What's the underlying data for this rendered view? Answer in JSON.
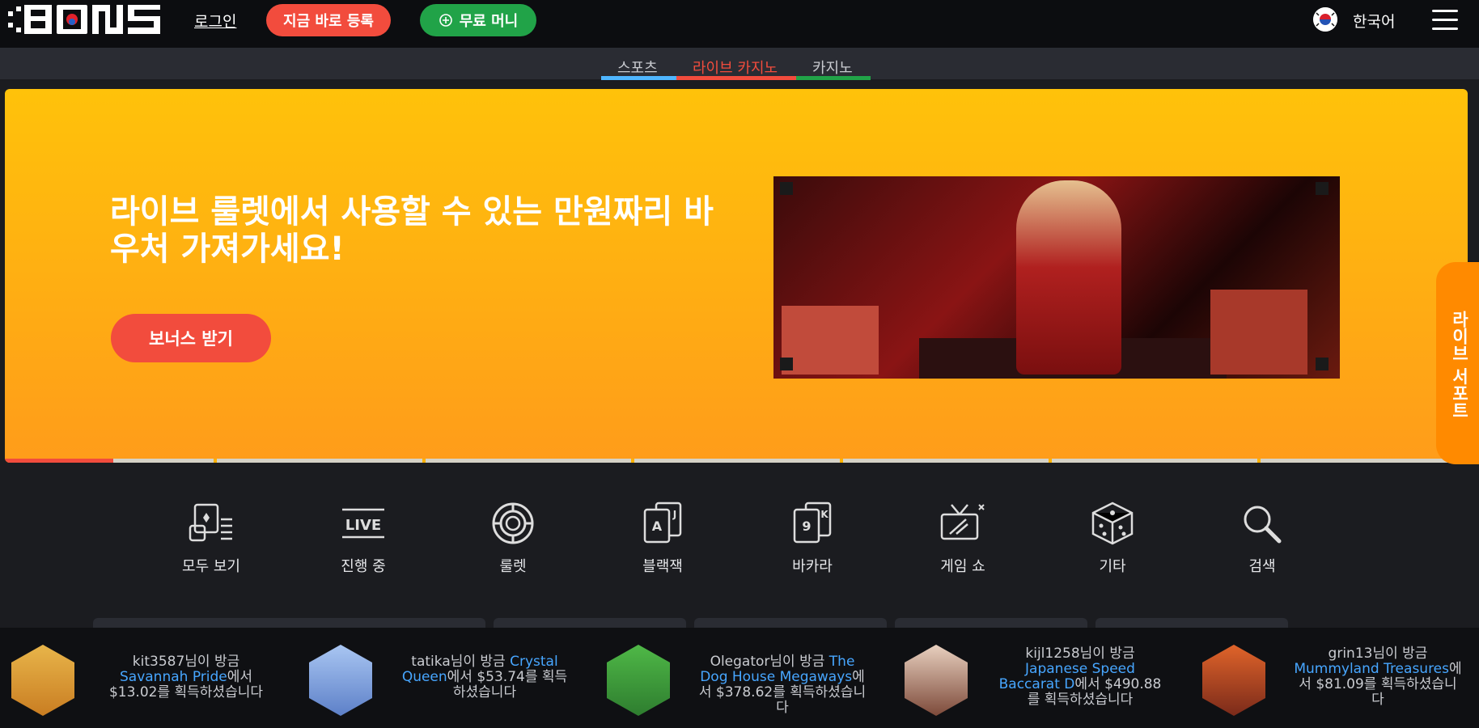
{
  "header": {
    "logo": "BONS",
    "login": "로그인",
    "register_button": "지금 바로 등록",
    "free_money_button": "무료 머니",
    "language": "한국어"
  },
  "tabs": [
    {
      "label": "스포츠",
      "color": "#4fb6ff"
    },
    {
      "label": "라이브 카지노",
      "color": "#f24c3d"
    },
    {
      "label": "카지노",
      "color": "#21a348"
    }
  ],
  "banner": {
    "title": "라이브 룰렛에서 사용할 수 있는 만원짜리 바우처 가져가세요!",
    "button": "보너스 받기"
  },
  "support": {
    "label": "라이브 서포트"
  },
  "categories": [
    {
      "label": "모두 보기",
      "icon": "all-games-icon"
    },
    {
      "label": "진행 중",
      "icon": "live-icon"
    },
    {
      "label": "룰렛",
      "icon": "roulette-icon"
    },
    {
      "label": "블랙잭",
      "icon": "blackjack-icon"
    },
    {
      "label": "바카라",
      "icon": "baccarat-icon"
    },
    {
      "label": "게임 쇼",
      "icon": "game-show-icon"
    },
    {
      "label": "기타",
      "icon": "dice-icon"
    },
    {
      "label": "검색",
      "icon": "search-icon"
    }
  ],
  "winners": [
    {
      "user": "kit3587",
      "pre": "님이 방금",
      "game": "Savannah Pride",
      "post": "에서 $13.02를 획득하셨습니다",
      "icon_color": "#e8b54a"
    },
    {
      "user": "tatika",
      "pre": "님이 방금",
      "game": "Crystal Queen",
      "post": "에서 $53.74를 획득하셨습니다",
      "icon_color": "#7fa6e0"
    },
    {
      "user": "Olegator",
      "pre": "님이 방금",
      "game": "The Dog House Megaways",
      "post": "에서 $378.62를 획득하셨습니다",
      "icon_color": "#3aa042"
    },
    {
      "user": "kijl1258",
      "pre": "님이 방금",
      "game": "Japanese Speed Baccarat D",
      "post": "에서 $490.88를 획득하셨습니다",
      "icon_color": "#d6b09a"
    },
    {
      "user": "grin13",
      "pre": "님이 방금",
      "game": "Mummyland Treasures",
      "post": "에서 $81.09를 획득하셨습니다",
      "icon_color": "#c2462a"
    }
  ],
  "colors": {
    "accent_red": "#f24c3d",
    "accent_green": "#21a348",
    "banner_top": "#ffc20a",
    "banner_bottom": "#ff9c1a"
  }
}
